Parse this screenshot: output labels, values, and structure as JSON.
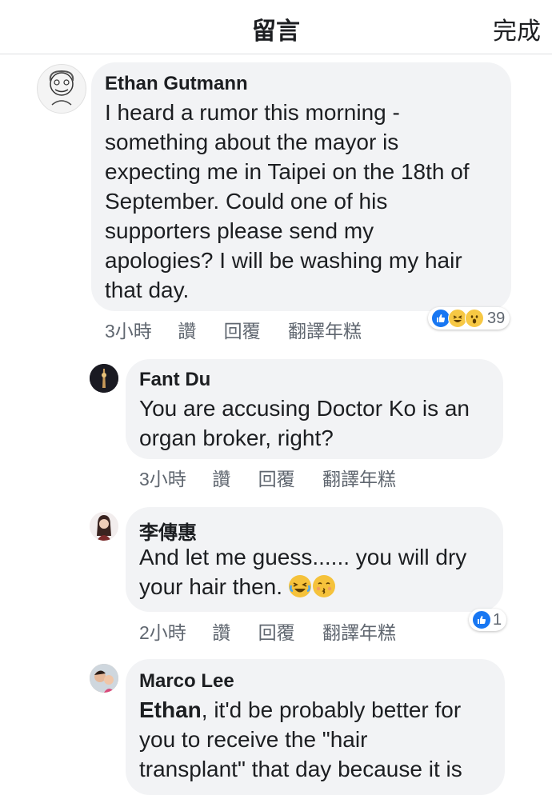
{
  "header": {
    "title": "留言",
    "done_label": "完成"
  },
  "comments": [
    {
      "author": "Ethan Gutmann",
      "lines": [
        "I heard a rumor this morning -",
        "something about the mayor is",
        "expecting me in Taipei on the 18th of",
        "September. Could one of his",
        "supporters please send my",
        "apologies? I will be washing my hair",
        "that day."
      ],
      "time": "3小時",
      "like": "讚",
      "reply": "回覆",
      "translate": "翻譯年糕",
      "reaction_count": "39",
      "reaction_icons": [
        "like-icon",
        "haha-icon",
        "wow-icon"
      ]
    },
    {
      "author": "Fant Du",
      "lines": [
        "You are accusing Doctor Ko is an",
        "organ broker, right?"
      ],
      "time": "3小時",
      "like": "讚",
      "reply": "回覆",
      "translate": "翻譯年糕"
    },
    {
      "author": "李傳惠",
      "lines": [
        "And let me guess...... you will dry",
        "your hair then."
      ],
      "emojis": [
        "laughing-tears-emoji",
        "kissing-emoji"
      ],
      "time": "2小時",
      "like": "讚",
      "reply": "回覆",
      "translate": "翻譯年糕",
      "reaction_count": "1",
      "reaction_icons": [
        "like-icon"
      ]
    },
    {
      "author": "Marco Lee",
      "mention": "Ethan",
      "line1_rest": ", it'd be probably better for",
      "lines": [
        "you to receive the \"hair",
        "transplant\" that day because it is"
      ]
    }
  ],
  "colors": {
    "bubble": "#f2f3f5",
    "like_blue": "#1877f2",
    "meta_gray": "#606770"
  }
}
